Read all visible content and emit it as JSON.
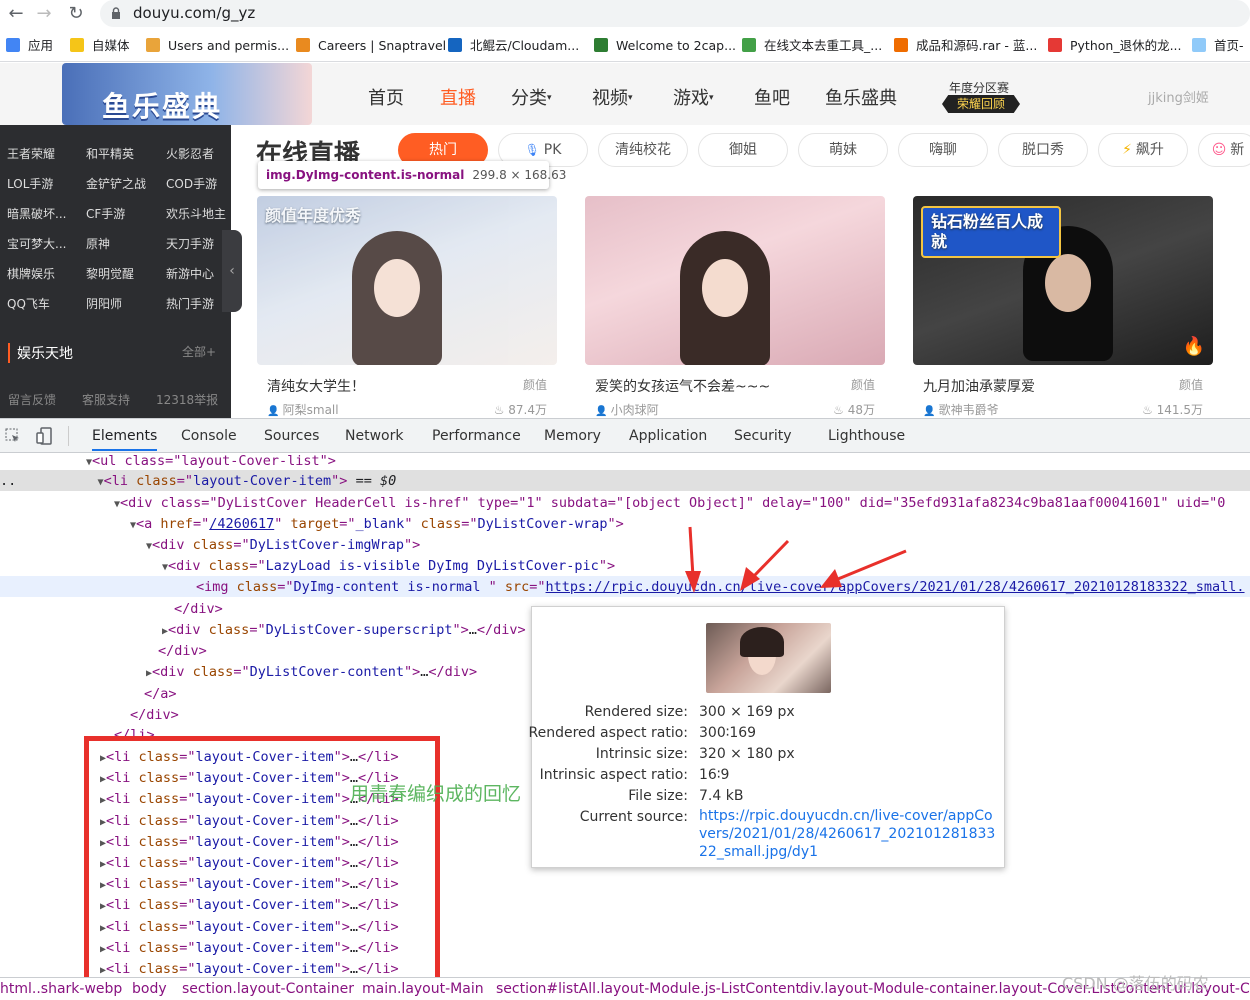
{
  "browser": {
    "url": "douyu.com/g_yz",
    "bookmarks": [
      "应用",
      "自媒体",
      "Users and permis...",
      "Careers | Snaptravel",
      "北鲲云/Cloudam...",
      "Welcome to 2cap...",
      "在线文本去重工具_...",
      "成品和源码.rar - 蓝...",
      "Python_退休的龙...",
      "首页-"
    ],
    "colors": {
      "bookmarks": [
        "#4285f4",
        "#f5c518",
        "#e9a43a",
        "#e98a1f",
        "#1565c0",
        "#2e7d32",
        "#43a047",
        "#ef6c00",
        "#e53935",
        "#90caf9"
      ]
    }
  },
  "site": {
    "logo_text": "鱼乐盛典",
    "nav": [
      "首页",
      "直播",
      "分类",
      "视频",
      "游戏",
      "鱼吧",
      "鱼乐盛典"
    ],
    "rank_badge": {
      "line1": "年度分区赛",
      "line2": "荣耀回顾"
    },
    "user_name": "jjking剑姬",
    "sidebar": {
      "rows": [
        [
          "王者荣耀",
          "和平精英",
          "火影忍者"
        ],
        [
          "LOL手游",
          "金铲铲之战",
          "COD手游"
        ],
        [
          "暗黑破坏...",
          "CF手游",
          "欢乐斗地主"
        ],
        [
          "宝可梦大...",
          "原神",
          "天刀手游"
        ],
        [
          "棋牌娱乐",
          "黎明觉醒",
          "新游中心"
        ],
        [
          "QQ飞车",
          "阴阳师",
          "热门手游"
        ]
      ],
      "section_title": "娱乐天地",
      "section_all": "全部+",
      "footer": [
        "留言反馈",
        "客服支持",
        "12318举报"
      ]
    },
    "page_title": "在线直播",
    "tags": [
      "热门",
      "PK",
      "清纯校花",
      "御姐",
      "萌妹",
      "嗨聊",
      "脱口秀",
      "飙升",
      "新"
    ],
    "inspect_tooltip": {
      "selector": "img.DyImg-content.is-normal",
      "size": "299.8 × 168.63"
    },
    "cards": [
      {
        "title": "清纯女大学生！",
        "category": "颜值",
        "anchor": "阿梨small",
        "heat": "87.4万",
        "banner": "颜值年度优秀"
      },
      {
        "title": "爱笑的女孩运气不会差~~~",
        "category": "颜值",
        "anchor": "小肉球阿",
        "heat": "48万",
        "banner": ""
      },
      {
        "title": "九月加油承蒙厚爱",
        "category": "颜值",
        "anchor": "歌神韦爵爷",
        "heat": "141.5万",
        "banner": "钻石粉丝百人成就"
      }
    ]
  },
  "devtools": {
    "tabs": [
      "Elements",
      "Console",
      "Sources",
      "Network",
      "Performance",
      "Memory",
      "Application",
      "Security",
      "Lighthouse"
    ],
    "dom": {
      "ul_line": "<ul class=\"layout-Cover-list\">",
      "li_sel_suffix": "== $0",
      "div_attrs": "<div class=\"DyListCover HeaderCell is-href\" type=\"1\" subdata=\"[object Object]\" delay=\"100\" did=\"35efd931afa8234c9ba81aaf00041601\" uid=\"0",
      "a_href": "/4260617",
      "img_src": "https://rpic.douyucdn.cn/live-cover/appCovers/2021/01/28/4260617_20210128183322_small."
    },
    "collapsed_items": 11,
    "annotation": "用青春编织成的回忆",
    "image_popup": {
      "rows": [
        {
          "label": "Rendered size:",
          "value": "300 × 169 px"
        },
        {
          "label": "Rendered aspect ratio:",
          "value": "300∶169"
        },
        {
          "label": "Intrinsic size:",
          "value": "320 × 180 px"
        },
        {
          "label": "Intrinsic aspect ratio:",
          "value": "16∶9"
        },
        {
          "label": "File size:",
          "value": "7.4 kB"
        },
        {
          "label": "Current source:",
          "value": ""
        }
      ],
      "current_source": "https://rpic.douyucdn.cn/live-cover/appCovers/2021/01/28/4260617_20210128183322_small.jpg/dy1"
    },
    "breadcrumbs": [
      "html..shark-webp",
      "body",
      "section.layout-Container",
      "main.layout-Main",
      "section#listAll.layout-Module.js-ListContent",
      "div.layout-Module-container.layout-Cover.ListContent",
      "ul.layout-Co"
    ]
  },
  "watermark": "CSDN @落伍的码农"
}
